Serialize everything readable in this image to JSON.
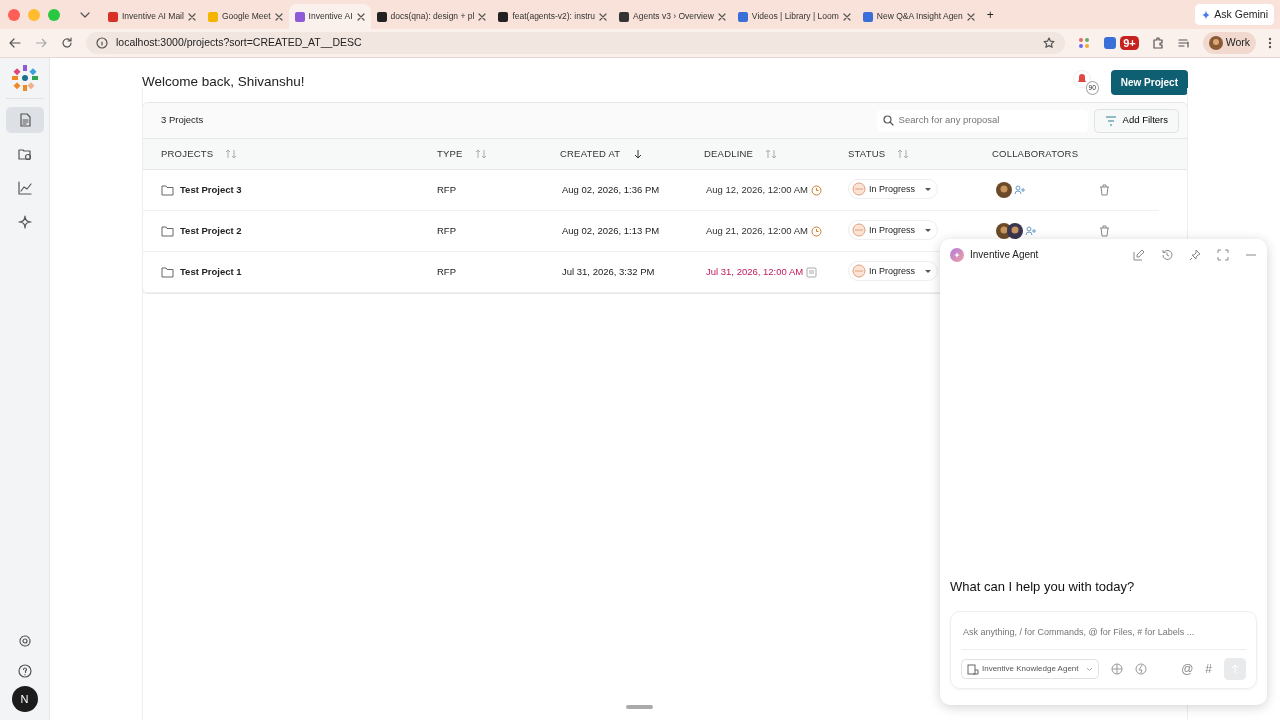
{
  "browser": {
    "tabs": [
      {
        "title": "Inventive AI Mail",
        "selected": false,
        "color": "#d93025"
      },
      {
        "title": "Google Meet",
        "selected": false,
        "color": "#f4b400"
      },
      {
        "title": "Inventive AI",
        "selected": true,
        "color": "#8e5bd8"
      },
      {
        "title": "docs(qna): design + pl",
        "selected": false,
        "color": "#222222"
      },
      {
        "title": "feat(agents-v2): instru",
        "selected": false,
        "color": "#222222"
      },
      {
        "title": "Agents v3 › Overview",
        "selected": false,
        "color": "#333333"
      },
      {
        "title": "Videos | Library | Loom",
        "selected": false,
        "color": "#3b6fd8"
      },
      {
        "title": "New Q&A Insight Agen",
        "selected": false,
        "color": "#3b6fd8"
      }
    ],
    "new_tab": "+",
    "ask_gemini": "Ask Gemini",
    "url": "localhost:3000/projects?sort=CREATED_AT__DESC",
    "extension_badge": "9+",
    "profile": "Work"
  },
  "sidebar": {
    "items": [
      {
        "kind": "document",
        "selected": true
      },
      {
        "kind": "folder",
        "selected": false
      },
      {
        "kind": "chart",
        "selected": false
      },
      {
        "kind": "sparkle",
        "selected": false
      }
    ],
    "user_initial": "N"
  },
  "header": {
    "greeting": "Welcome back, Shivanshu!",
    "notification_count": "90",
    "new_project": "New Project"
  },
  "table": {
    "count": "3 Projects",
    "search": {
      "placeholder": "Search for any proposal"
    },
    "filter_button": "Add Filters",
    "columns": [
      {
        "label": "PROJECTS",
        "sortable": true,
        "sorted_descending": false
      },
      {
        "label": "TYPE",
        "sortable": true,
        "sorted_descending": false
      },
      {
        "label": "CREATED AT",
        "sortable": true,
        "sorted_descending": true
      },
      {
        "label": "DEADLINE",
        "sortable": true,
        "sorted_descending": false
      },
      {
        "label": "STATUS",
        "sortable": true,
        "sorted_descending": false
      },
      {
        "label": "COLLABORATORS",
        "sortable": false
      }
    ],
    "rows": [
      {
        "name": "Test Project 3",
        "type": "RFP",
        "created_at": "Aug 02, 2026, 1:36 PM",
        "deadline": "Aug 12, 2026, 12:00 AM",
        "overdue": false,
        "status": "In Progress",
        "collaborators": [
          {
            "kind": "photo"
          }
        ],
        "delete_visible": true
      },
      {
        "name": "Test Project 2",
        "type": "RFP",
        "created_at": "Aug 02, 2026, 1:13 PM",
        "deadline": "Aug 21, 2026, 12:00 AM",
        "overdue": false,
        "status": "In Progress",
        "collaborators": [
          {
            "kind": "photo"
          },
          {
            "kind": "photo"
          }
        ],
        "delete_visible": true
      },
      {
        "name": "Test Project 1",
        "type": "RFP",
        "created_at": "Jul 31, 2026, 3:32 PM",
        "deadline": "Jul 31, 2026, 12:00 AM",
        "overdue": true,
        "status": "In Progress",
        "delete_visible": false
      }
    ]
  },
  "agent": {
    "title": "Inventive Agent",
    "prompt": "What can I help you with today?",
    "input": {
      "placeholder": "Ask anything, / for Commands, @ for Files, # for Labels ..."
    },
    "agent_select": "Inventive Knowledge Agent",
    "mention_key": "@",
    "label_key": "#"
  }
}
